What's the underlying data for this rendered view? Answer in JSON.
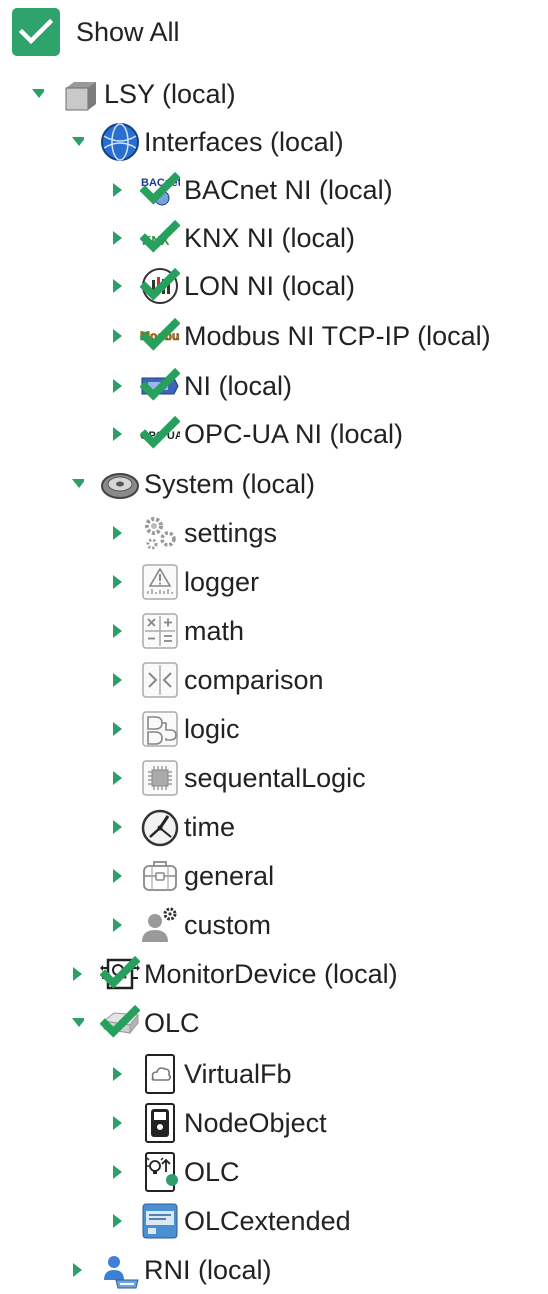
{
  "show_all": {
    "label": "Show All",
    "checked": true
  },
  "tree": {
    "lsy": "LSY (local)",
    "interfaces": "Interfaces (local)",
    "bacnet": "BACnet NI (local)",
    "knx": "KNX NI (local)",
    "lon": "LON NI (local)",
    "modbus": "Modbus NI TCP-IP (local)",
    "ni": "NI (local)",
    "opcua": "OPC-UA NI (local)",
    "system": "System (local)",
    "settings": "settings",
    "logger": "logger",
    "math": "math",
    "comparison": "comparison",
    "logic": "logic",
    "sequentallogic": "sequentalLogic",
    "time": "time",
    "general": "general",
    "custom": "custom",
    "monitordevice": "MonitorDevice (local)",
    "olc": "OLC",
    "virtualfb": "VirtualFb",
    "nodeobject": "NodeObject",
    "olc_child": "OLC",
    "olcextended": "OLCextended",
    "rni": "RNI (local)"
  },
  "icon_text": {
    "bacnet": "BACnet",
    "knx": "KNX",
    "modbus": "Modbus",
    "opcua": "OPC UA"
  },
  "colors": {
    "accent": "#2ea36b",
    "chevron": "#2e9e6a",
    "check": "#27a05d"
  }
}
